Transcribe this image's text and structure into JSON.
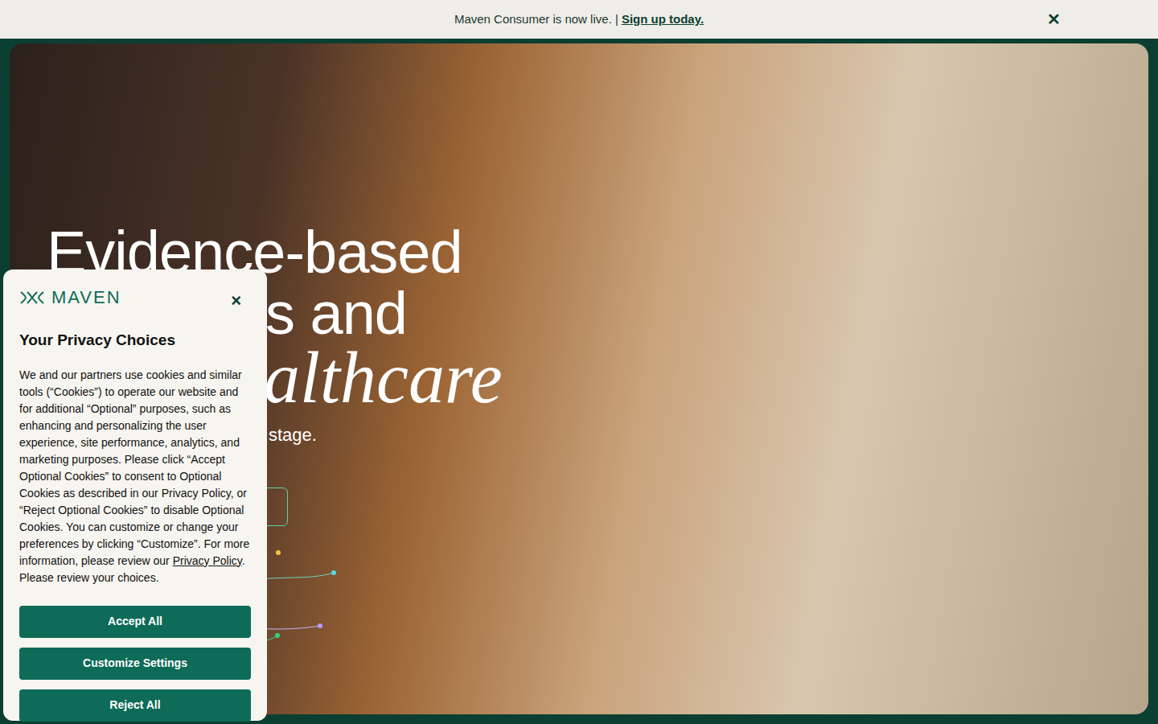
{
  "banner": {
    "text": "Maven Consumer is now live. |",
    "link": "Sign up today.",
    "close": "✕"
  },
  "hero": {
    "lines": [
      "Evidence-based",
      "s and",
      "althcare"
    ],
    "subtitle": "stage."
  },
  "privacy": {
    "logo": "MAVEN",
    "close": "×",
    "title": "Your Privacy Choices",
    "body_before": "We and our partners use cookies and similar tools (“Cookies”) to operate our website and for additional “Optional” purposes, such as enhancing and personalizing the user experience, site performance, analytics, and marketing purposes. Please click “Accept Optional Cookies” to consent to Optional Cookies as described in our Privacy Policy, or “Reject Optional Cookies” to disable Optional Cookies.  You can customize or change your preferences by clicking “Customize”. For more information, please review our ",
    "body_link": "Privacy Policy",
    "body_after": ". Please review your choices.",
    "buttons": [
      "Accept All",
      "Customize Settings",
      "Reject All"
    ]
  }
}
